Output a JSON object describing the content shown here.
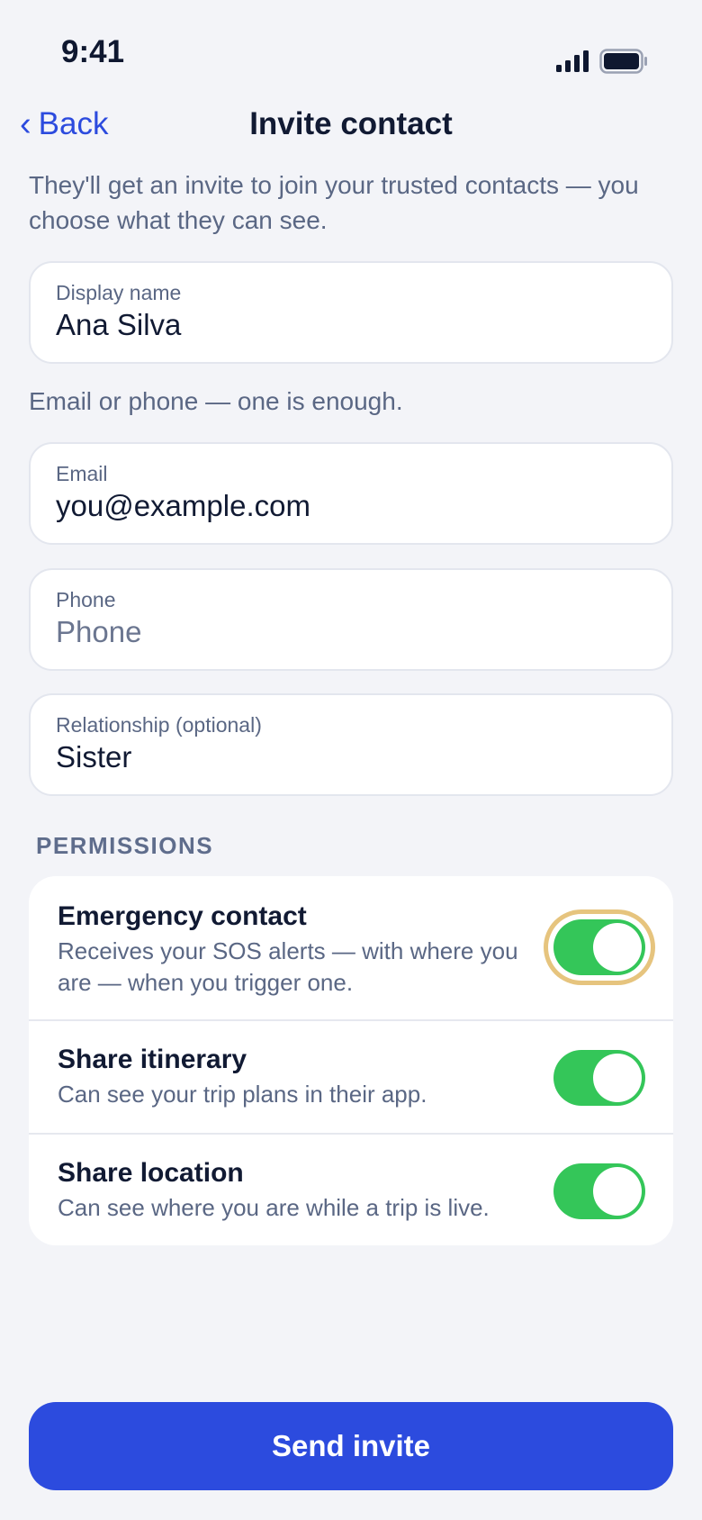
{
  "status_bar": {
    "time": "9:41"
  },
  "nav": {
    "back_label": "Back",
    "back_icon": "chevron-left",
    "title": "Invite contact"
  },
  "intro": "They'll get an invite to join your trusted contacts — you choose what they can see.",
  "fields": {
    "display_name": {
      "label": "Display name",
      "value": "Ana Silva"
    },
    "email": {
      "label": "Email",
      "value": "you@example.com"
    },
    "phone": {
      "label": "Phone",
      "value": "",
      "placeholder": "Phone"
    },
    "relationship": {
      "label": "Relationship (optional)",
      "value": "Sister"
    }
  },
  "contact_hint": "Email or phone — one is enough.",
  "permissions": {
    "heading": "PERMISSIONS",
    "items": [
      {
        "title": "Emergency contact",
        "description": "Receives your SOS alerts — with where you are — when you trigger one.",
        "enabled": true,
        "focused": true
      },
      {
        "title": "Share itinerary",
        "description": "Can see your trip plans in their app.",
        "enabled": true,
        "focused": false
      },
      {
        "title": "Share location",
        "description": "Can see where you are while a trip is live.",
        "enabled": true,
        "focused": false
      }
    ]
  },
  "send_button": "Send invite",
  "colors": {
    "accent": "#2c4bde",
    "toggle_on": "#34c659",
    "focus_ring": "#e6c47e",
    "background": "#f3f4f8"
  }
}
